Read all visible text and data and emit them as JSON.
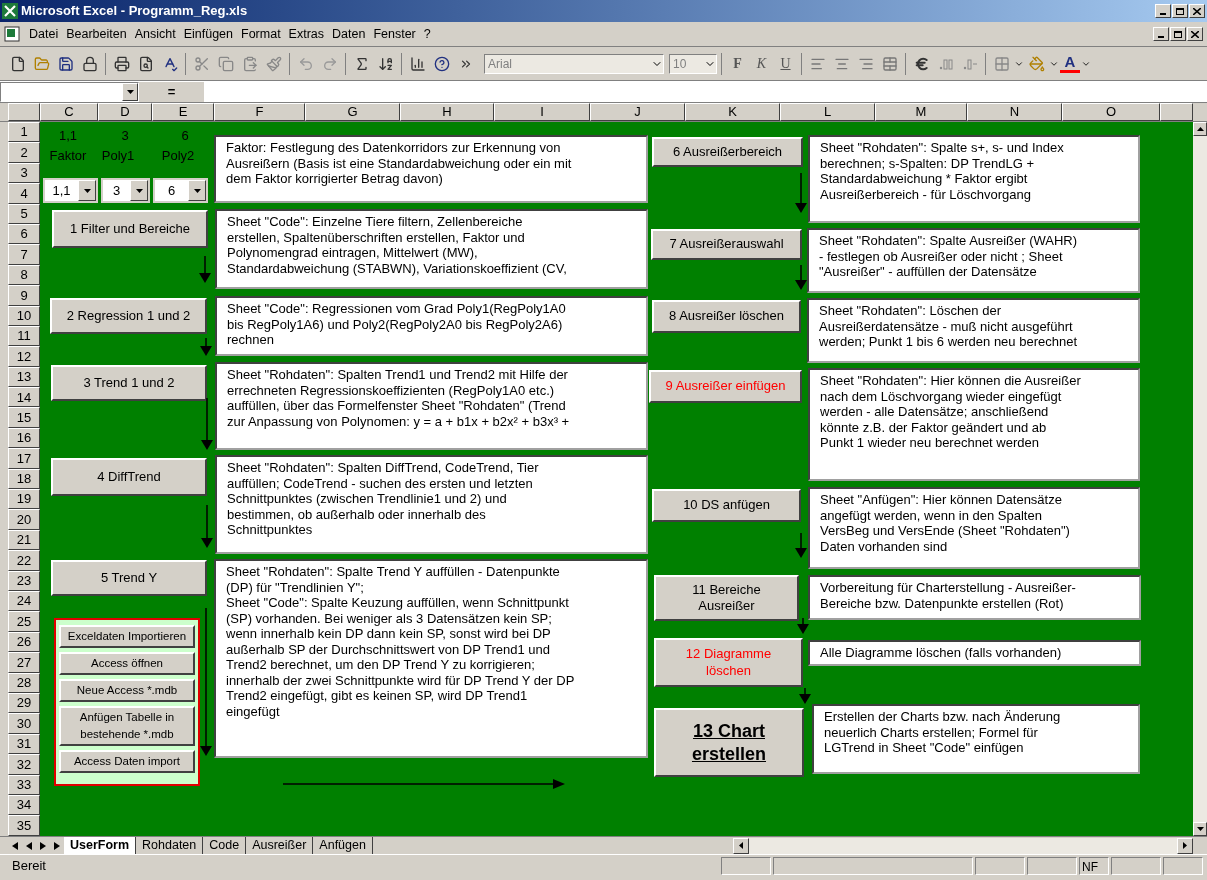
{
  "window": {
    "title": "Microsoft Excel - Programm_Reg.xls"
  },
  "menu": [
    "Datei",
    "Bearbeiten",
    "Ansicht",
    "Einfügen",
    "Format",
    "Extras",
    "Daten",
    "Fenster",
    "?"
  ],
  "toolbar": {
    "font_name": "Arial",
    "font_size": "10",
    "bold": "F",
    "italic": "K",
    "underline": "U",
    "font_color": "A"
  },
  "formula_bar": {
    "equals": "="
  },
  "columns": [
    "C",
    "D",
    "E",
    "F",
    "G",
    "H",
    "I",
    "J",
    "K",
    "L",
    "M",
    "N",
    "O"
  ],
  "rows": [
    "1",
    "2",
    "3",
    "4",
    "5",
    "6",
    "7",
    "8",
    "9",
    "10",
    "11",
    "12",
    "13",
    "14",
    "15",
    "16",
    "17",
    "18",
    "19",
    "20",
    "21",
    "22",
    "23",
    "24",
    "25",
    "26",
    "27",
    "28",
    "29",
    "30",
    "31",
    "32",
    "33",
    "34",
    "35"
  ],
  "parameters": [
    {
      "heading": "1,1",
      "label": "Faktor",
      "value": "1,1"
    },
    {
      "heading": "3",
      "label": "Poly1",
      "value": "3"
    },
    {
      "heading": "6",
      "label": "Poly2",
      "value": "6"
    }
  ],
  "parameter_note": "Faktor: Festlegung des Datenkorridors zur Erkennung von\nAusreißern (Basis ist eine Standardabweichung oder ein mit\ndem Faktor korrigierter Betrag davon)",
  "steps": [
    {
      "button": "1 Filter und Bereiche",
      "kind": "normal",
      "description": "Sheet \"Code\": Einzelne Tiere filtern, Zellenbereiche\nerstellen, Spaltenüberschriften erstellen, Faktor und\nPolynomengrad eintragen, Mittelwert (MW),\nStandardabweichung (STABWN), Variationskoeffizient (CV,"
    },
    {
      "button": "2 Regression 1 und 2",
      "kind": "normal",
      "description": "Sheet \"Code\": Regressionen vom Grad Poly1(RegPoly1A0\nbis RegPoly1A6) und Poly2(RegPoly2A0 bis RegPoly2A6)\nrechnen"
    },
    {
      "button": "3 Trend 1 und 2",
      "kind": "normal",
      "description": "Sheet \"Rohdaten\": Spalten Trend1 und Trend2 mit Hilfe der\nerrechneten Regressionskoeffizienten (RegPoly1A0 etc.)\nauffüllen, über das Formelfenster Sheet \"Rohdaten\" (Trend\nzur Anpassung von Polynomen: y = a + b1x + b2x² + b3x³ +"
    },
    {
      "button": "4 DiffTrend",
      "kind": "normal",
      "description": "Sheet \"Rohdaten\": Spalten DiffTrend, CodeTrend, Tier\nauffüllen; CodeTrend - suchen des ersten und letzten\nSchnittpunktes (zwischen Trendlinie1 und 2) und\nbestimmen, ob außerhalb oder innerhalb des\nSchnittpunktes"
    },
    {
      "button": "5 Trend Y",
      "kind": "normal",
      "description": "Sheet \"Rohdaten\": Spalte Trend Y auffüllen - Datenpunkte\n(DP) für \"Trendlinien Y\";\nSheet \"Code\": Spalte Keuzung auffüllen, wenn Schnittpunkt\n(SP) vorhanden. Bei weniger als 3 Datensätzen kein SP;\nwenn innerhalb kein DP dann kein SP, sonst wird bei DP\naußerhalb SP der Durchschnittswert von DP Trend1 und\nTrend2 berechnet, um den DP Trend Y zu korrigieren;\ninnerhalb der zwei Schnittpunkte wird für DP Trend Y der DP\nTrend2 eingefügt, gibt es keinen SP, wird DP Trend1\neingefügt"
    },
    {
      "button": "6 Ausreißerbereich",
      "kind": "normal",
      "description": "Sheet \"Rohdaten\": Spalte s+, s- und Index\nberechnen; s-Spalten: DP TrendLG +\nStandardabweichung * Faktor ergibt\nAusreißerbereich - für Löschvorgang"
    },
    {
      "button": "7 Ausreißerauswahl",
      "kind": "normal",
      "description": "Sheet \"Rohdaten\": Spalte Ausreißer (WAHR)\n- festlegen ob Ausreißer oder nicht ; Sheet\n\"Ausreißer\" - auffüllen der Datensätze"
    },
    {
      "button": "8 Ausreißer löschen",
      "kind": "normal",
      "description": "Sheet \"Rohdaten\": Löschen der\nAusreißerdatensätze - muß nicht ausgeführt\nwerden; Punkt 1 bis 6 werden neu berechnet"
    },
    {
      "button": "9 Ausreißer einfügen",
      "kind": "warning",
      "description": "Sheet \"Rohdaten\": Hier können die Ausreißer\nnach dem Löschvorgang wieder eingefügt\nwerden - alle Datensätze; anschließend\nkönnte z.B. der Faktor geändert und ab\nPunkt 1 wieder neu berechnet werden"
    },
    {
      "button": "10 DS anfügen",
      "kind": "normal",
      "description": "Sheet \"Anfügen\": Hier können Datensätze\nangefügt werden, wenn in den Spalten\nVersBeg und VersEnde (Sheet \"Rohdaten\")\nDaten vorhanden sind"
    },
    {
      "button": "11 Bereiche\nAusreißer",
      "kind": "normal",
      "description": "Vorbereitung für Charterstellung - Ausreißer-\nBereiche bzw. Datenpunkte erstellen (Rot)"
    },
    {
      "button": "12 Diagramme\nlöschen",
      "kind": "warning",
      "description": "Alle Diagramme löschen (falls vorhanden)"
    },
    {
      "button": "13 Chart\nerstellen",
      "kind": "primary",
      "description": "Erstellen der Charts bzw. nach Änderung\nneuerlich Charts erstellen; Formel für\nLGTrend in Sheet \"Code\" einfügen"
    }
  ],
  "access_panel": [
    "Exceldaten Importieren",
    "Access öffnen",
    "Neue Access *.mdb",
    "Anfügen Tabelle in\nbestehende *.mdb",
    "Access Daten import"
  ],
  "sheet_tabs": [
    {
      "label": "UserForm",
      "selected": true
    },
    {
      "label": "Rohdaten",
      "selected": false
    },
    {
      "label": "Code",
      "selected": false
    },
    {
      "label": "Ausreißer",
      "selected": false
    },
    {
      "label": "Anfügen",
      "selected": false
    }
  ],
  "status_bar": {
    "text": "Bereit",
    "indicators": [
      "NF"
    ]
  }
}
